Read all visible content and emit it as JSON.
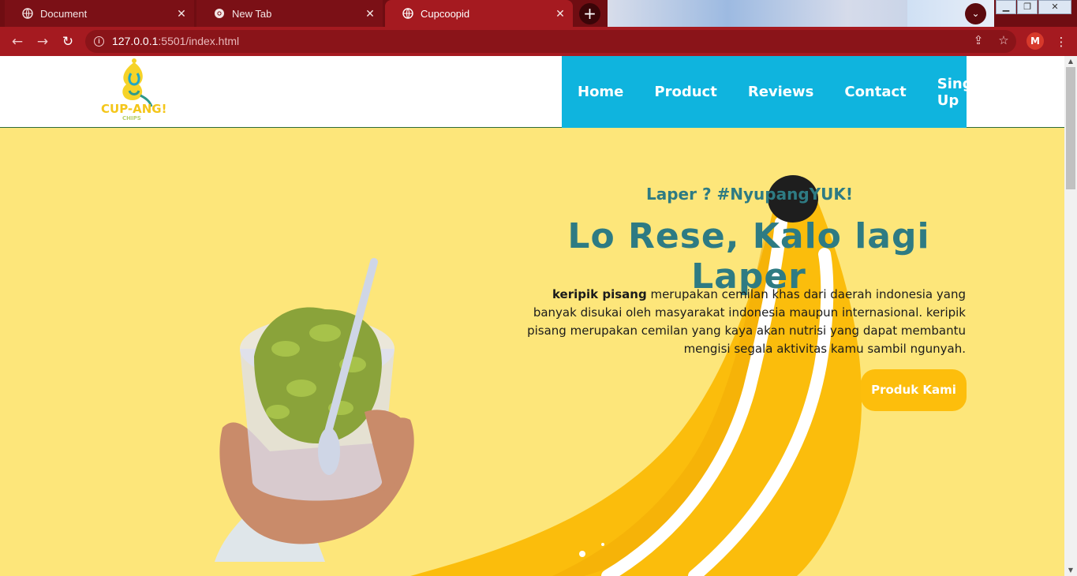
{
  "browser": {
    "tabs": [
      {
        "title": "Document",
        "icon": "globe-icon"
      },
      {
        "title": "New Tab",
        "icon": "chrome-icon"
      },
      {
        "title": "Cupcoopid",
        "icon": "globe-icon",
        "active": true
      }
    ],
    "url_host": "127.0.0.1",
    "url_path": ":5501/index.html",
    "profile_initial": "M",
    "theme_color": "#a51a20"
  },
  "site": {
    "logo_text": "CUP-ANG!",
    "logo_sub": "CHIPS",
    "nav": [
      "Home",
      "Product",
      "Reviews",
      "Contact",
      "Sing Up"
    ],
    "nav_color": "#0fb4de",
    "hero": {
      "tagline": "Laper ? #NyupangYUK!",
      "headline": "Lo Rese, Kalo lagi Laper",
      "desc_bold": "keripik pisang",
      "desc_rest": " merupakan cemilan khas dari daerah indonesia yang banyak disukai oleh masyarakat indonesia maupun internasional. keripik pisang merupakan cemilan yang kaya akan nutrisi yang dapat membantu mengisi segala aktivitas kamu sambil ngunyah.",
      "cta": "Produk Kami",
      "background": "#fde67a",
      "accent": "#fdbe0c",
      "text_color": "#2e7b83"
    }
  }
}
